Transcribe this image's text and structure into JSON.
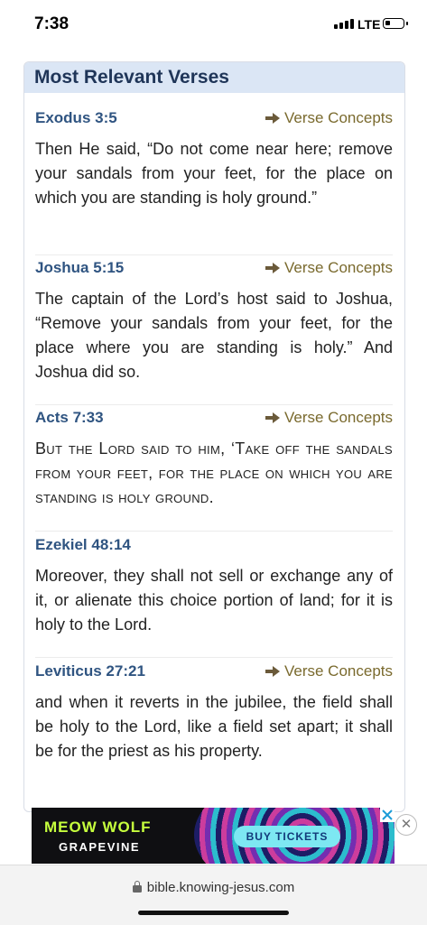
{
  "status_bar": {
    "time": "7:38",
    "network": "LTE",
    "battery_level": 0.3
  },
  "panel": {
    "title": "Most Relevant Verses"
  },
  "concepts_label": "Verse Concepts",
  "verses": [
    {
      "ref": "Exodus 3:5",
      "has_concepts": true,
      "text": "Then He said, “Do not come near here; remove your sandals from your feet, for the place on which you are standing is holy ground.”"
    },
    {
      "ref": "Joshua 5:15",
      "has_concepts": true,
      "text": "The captain of the Lord’s host said to Joshua, “Remove your sandals from your feet, for the place where you are standing is holy.” And Joshua did so."
    },
    {
      "ref": "Acts 7:33",
      "has_concepts": true,
      "text": "But the Lord said to him, ‘Take off the sandals from your feet, for the place on which you are standing is holy ground."
    },
    {
      "ref": "Ezekiel 48:14",
      "has_concepts": false,
      "text": "Moreover, they shall not sell or exchange any of it, or alienate this choice portion of land; for it is holy to the Lord."
    },
    {
      "ref": "Leviticus 27:21",
      "has_concepts": true,
      "text": "and when it reverts in the jubilee, the field shall be holy to the Lord, like a field set apart; it shall be for the priest as his property."
    }
  ],
  "ad": {
    "brand_line1": "MEOW WOLF",
    "brand_line2": "GRAPEVINE",
    "cta": "BUY TICKETS"
  },
  "browser": {
    "url": "bible.knowing-jesus.com"
  }
}
